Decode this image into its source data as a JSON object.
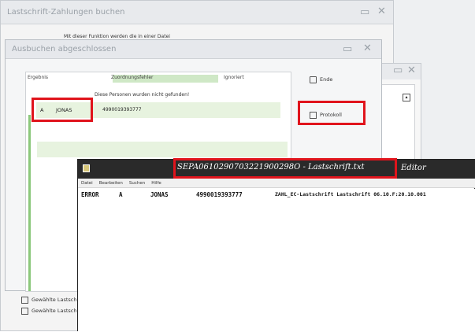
{
  "window1": {
    "title": "Lastschrift-Zahlungen buchen",
    "info_text": "Mit dieser Funktion werden die in einer Datei",
    "buttons": [
      {
        "label": "Gewählte Lastschriften"
      },
      {
        "label": "Gewählte Lastschriften"
      }
    ]
  },
  "window3": {
    "title": "Ausbuchen abgeschlossen",
    "columns": {
      "result": "Ergebnis",
      "error": "Zuordnungsfehler",
      "ignored": "Ignoriert"
    },
    "message": "Diese Personen wurden nicht gefunden!",
    "row": {
      "initial": "A",
      "name": "JONAS",
      "number": "4990019393777"
    },
    "btn_end": "Ende",
    "btn_protocol": "Protokoll"
  },
  "editor": {
    "title": "SEPA0610290703221900298O - Lastschrift.txt",
    "app_name": "Editor",
    "menu": [
      "Datei",
      "Bearbeiten",
      "Suchen",
      "Hilfe"
    ],
    "line": {
      "status": "ERROR",
      "initial": "A",
      "name": "JONAS",
      "number": "4990019393777",
      "detail": "ZAHL_EC-Lastschrift Lastschrift 06.10.F:20.10.001"
    }
  },
  "colors": {
    "highlight": "#e0141c",
    "selection": "#cfe8c6"
  },
  "icons": {
    "minimize": "minimize-icon",
    "close": "close-icon",
    "exit": "exit-icon",
    "protocol": "document-icon"
  }
}
